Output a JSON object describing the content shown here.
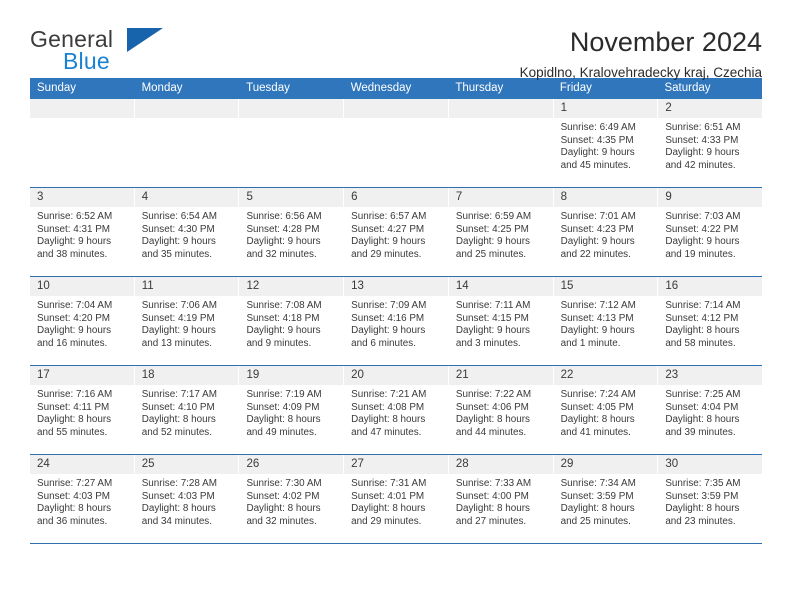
{
  "brand": {
    "name_part1": "General",
    "name_part2": "Blue",
    "triangle_icon": "triangle-logo-icon",
    "accent_blue": "#1b82d2",
    "triangle_blue": "#1763ac"
  },
  "header": {
    "title": "November 2024",
    "subtitle": "Kopidlno, Kralovehradecky kraj, Czechia"
  },
  "calendar": {
    "header_color": "#3076BC",
    "daynum_bar_color": "#f0f0f0",
    "weekdays": [
      "Sunday",
      "Monday",
      "Tuesday",
      "Wednesday",
      "Thursday",
      "Friday",
      "Saturday"
    ],
    "weeks": [
      [
        {
          "day": "",
          "sunrise": "",
          "sunset": "",
          "daylight1": "",
          "daylight2": ""
        },
        {
          "day": "",
          "sunrise": "",
          "sunset": "",
          "daylight1": "",
          "daylight2": ""
        },
        {
          "day": "",
          "sunrise": "",
          "sunset": "",
          "daylight1": "",
          "daylight2": ""
        },
        {
          "day": "",
          "sunrise": "",
          "sunset": "",
          "daylight1": "",
          "daylight2": ""
        },
        {
          "day": "",
          "sunrise": "",
          "sunset": "",
          "daylight1": "",
          "daylight2": ""
        },
        {
          "day": "1",
          "sunrise": "Sunrise: 6:49 AM",
          "sunset": "Sunset: 4:35 PM",
          "daylight1": "Daylight: 9 hours",
          "daylight2": "and 45 minutes."
        },
        {
          "day": "2",
          "sunrise": "Sunrise: 6:51 AM",
          "sunset": "Sunset: 4:33 PM",
          "daylight1": "Daylight: 9 hours",
          "daylight2": "and 42 minutes."
        }
      ],
      [
        {
          "day": "3",
          "sunrise": "Sunrise: 6:52 AM",
          "sunset": "Sunset: 4:31 PM",
          "daylight1": "Daylight: 9 hours",
          "daylight2": "and 38 minutes."
        },
        {
          "day": "4",
          "sunrise": "Sunrise: 6:54 AM",
          "sunset": "Sunset: 4:30 PM",
          "daylight1": "Daylight: 9 hours",
          "daylight2": "and 35 minutes."
        },
        {
          "day": "5",
          "sunrise": "Sunrise: 6:56 AM",
          "sunset": "Sunset: 4:28 PM",
          "daylight1": "Daylight: 9 hours",
          "daylight2": "and 32 minutes."
        },
        {
          "day": "6",
          "sunrise": "Sunrise: 6:57 AM",
          "sunset": "Sunset: 4:27 PM",
          "daylight1": "Daylight: 9 hours",
          "daylight2": "and 29 minutes."
        },
        {
          "day": "7",
          "sunrise": "Sunrise: 6:59 AM",
          "sunset": "Sunset: 4:25 PM",
          "daylight1": "Daylight: 9 hours",
          "daylight2": "and 25 minutes."
        },
        {
          "day": "8",
          "sunrise": "Sunrise: 7:01 AM",
          "sunset": "Sunset: 4:23 PM",
          "daylight1": "Daylight: 9 hours",
          "daylight2": "and 22 minutes."
        },
        {
          "day": "9",
          "sunrise": "Sunrise: 7:03 AM",
          "sunset": "Sunset: 4:22 PM",
          "daylight1": "Daylight: 9 hours",
          "daylight2": "and 19 minutes."
        }
      ],
      [
        {
          "day": "10",
          "sunrise": "Sunrise: 7:04 AM",
          "sunset": "Sunset: 4:20 PM",
          "daylight1": "Daylight: 9 hours",
          "daylight2": "and 16 minutes."
        },
        {
          "day": "11",
          "sunrise": "Sunrise: 7:06 AM",
          "sunset": "Sunset: 4:19 PM",
          "daylight1": "Daylight: 9 hours",
          "daylight2": "and 13 minutes."
        },
        {
          "day": "12",
          "sunrise": "Sunrise: 7:08 AM",
          "sunset": "Sunset: 4:18 PM",
          "daylight1": "Daylight: 9 hours",
          "daylight2": "and 9 minutes."
        },
        {
          "day": "13",
          "sunrise": "Sunrise: 7:09 AM",
          "sunset": "Sunset: 4:16 PM",
          "daylight1": "Daylight: 9 hours",
          "daylight2": "and 6 minutes."
        },
        {
          "day": "14",
          "sunrise": "Sunrise: 7:11 AM",
          "sunset": "Sunset: 4:15 PM",
          "daylight1": "Daylight: 9 hours",
          "daylight2": "and 3 minutes."
        },
        {
          "day": "15",
          "sunrise": "Sunrise: 7:12 AM",
          "sunset": "Sunset: 4:13 PM",
          "daylight1": "Daylight: 9 hours",
          "daylight2": "and 1 minute."
        },
        {
          "day": "16",
          "sunrise": "Sunrise: 7:14 AM",
          "sunset": "Sunset: 4:12 PM",
          "daylight1": "Daylight: 8 hours",
          "daylight2": "and 58 minutes."
        }
      ],
      [
        {
          "day": "17",
          "sunrise": "Sunrise: 7:16 AM",
          "sunset": "Sunset: 4:11 PM",
          "daylight1": "Daylight: 8 hours",
          "daylight2": "and 55 minutes."
        },
        {
          "day": "18",
          "sunrise": "Sunrise: 7:17 AM",
          "sunset": "Sunset: 4:10 PM",
          "daylight1": "Daylight: 8 hours",
          "daylight2": "and 52 minutes."
        },
        {
          "day": "19",
          "sunrise": "Sunrise: 7:19 AM",
          "sunset": "Sunset: 4:09 PM",
          "daylight1": "Daylight: 8 hours",
          "daylight2": "and 49 minutes."
        },
        {
          "day": "20",
          "sunrise": "Sunrise: 7:21 AM",
          "sunset": "Sunset: 4:08 PM",
          "daylight1": "Daylight: 8 hours",
          "daylight2": "and 47 minutes."
        },
        {
          "day": "21",
          "sunrise": "Sunrise: 7:22 AM",
          "sunset": "Sunset: 4:06 PM",
          "daylight1": "Daylight: 8 hours",
          "daylight2": "and 44 minutes."
        },
        {
          "day": "22",
          "sunrise": "Sunrise: 7:24 AM",
          "sunset": "Sunset: 4:05 PM",
          "daylight1": "Daylight: 8 hours",
          "daylight2": "and 41 minutes."
        },
        {
          "day": "23",
          "sunrise": "Sunrise: 7:25 AM",
          "sunset": "Sunset: 4:04 PM",
          "daylight1": "Daylight: 8 hours",
          "daylight2": "and 39 minutes."
        }
      ],
      [
        {
          "day": "24",
          "sunrise": "Sunrise: 7:27 AM",
          "sunset": "Sunset: 4:03 PM",
          "daylight1": "Daylight: 8 hours",
          "daylight2": "and 36 minutes."
        },
        {
          "day": "25",
          "sunrise": "Sunrise: 7:28 AM",
          "sunset": "Sunset: 4:03 PM",
          "daylight1": "Daylight: 8 hours",
          "daylight2": "and 34 minutes."
        },
        {
          "day": "26",
          "sunrise": "Sunrise: 7:30 AM",
          "sunset": "Sunset: 4:02 PM",
          "daylight1": "Daylight: 8 hours",
          "daylight2": "and 32 minutes."
        },
        {
          "day": "27",
          "sunrise": "Sunrise: 7:31 AM",
          "sunset": "Sunset: 4:01 PM",
          "daylight1": "Daylight: 8 hours",
          "daylight2": "and 29 minutes."
        },
        {
          "day": "28",
          "sunrise": "Sunrise: 7:33 AM",
          "sunset": "Sunset: 4:00 PM",
          "daylight1": "Daylight: 8 hours",
          "daylight2": "and 27 minutes."
        },
        {
          "day": "29",
          "sunrise": "Sunrise: 7:34 AM",
          "sunset": "Sunset: 3:59 PM",
          "daylight1": "Daylight: 8 hours",
          "daylight2": "and 25 minutes."
        },
        {
          "day": "30",
          "sunrise": "Sunrise: 7:35 AM",
          "sunset": "Sunset: 3:59 PM",
          "daylight1": "Daylight: 8 hours",
          "daylight2": "and 23 minutes."
        }
      ]
    ]
  }
}
